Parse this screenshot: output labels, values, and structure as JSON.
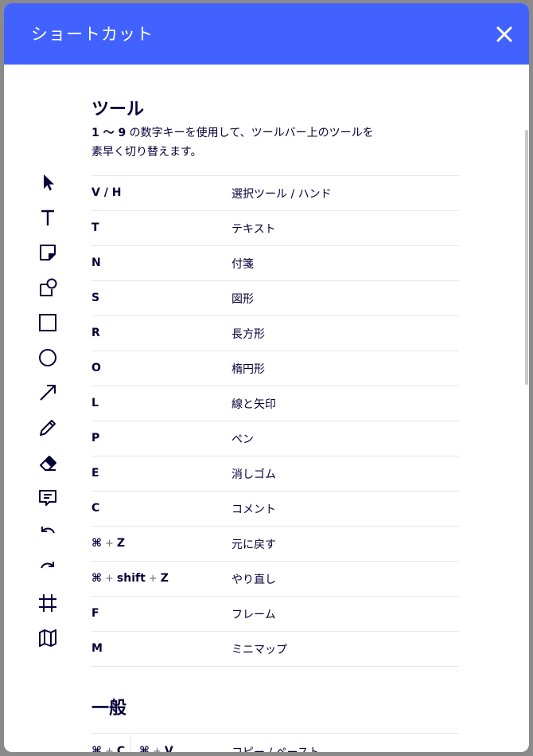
{
  "header": {
    "title": "ショートカット",
    "close_icon": "close-icon"
  },
  "accent_color": "#4262ff",
  "tools_section": {
    "title": "ツール",
    "desc_bold": "1 〜 9",
    "desc_line1": " の数字キーを使用して、ツールバー上のツールを",
    "desc_line2": "素早く切り替えます。",
    "rows": [
      {
        "key": "V / H",
        "label": "選択ツール / ハンド",
        "icon": "cursor-icon"
      },
      {
        "key": "T",
        "label": "テキスト",
        "icon": "text-icon"
      },
      {
        "key": "N",
        "label": "付箋",
        "icon": "sticky-note-icon"
      },
      {
        "key": "S",
        "label": "図形",
        "icon": "shapes-icon"
      },
      {
        "key": "R",
        "label": "長方形",
        "icon": "rectangle-icon"
      },
      {
        "key": "O",
        "label": "楕円形",
        "icon": "ellipse-icon"
      },
      {
        "key": "L",
        "label": "線と矢印",
        "icon": "arrow-icon"
      },
      {
        "key": "P",
        "label": "ペン",
        "icon": "pen-icon"
      },
      {
        "key": "E",
        "label": "消しゴム",
        "icon": "eraser-icon"
      },
      {
        "key": "C",
        "label": "コメント",
        "icon": "comment-icon"
      },
      {
        "key_cmd": "⌘",
        "key_plus": "+",
        "key_last": "Z",
        "label": "元に戻す",
        "icon": "undo-icon"
      },
      {
        "key_cmd": "⌘",
        "key_plus": "+",
        "key_mid": "shift",
        "key_plus2": "+",
        "key_last": "Z",
        "label": "やり直し",
        "icon": "redo-icon"
      },
      {
        "key": "F",
        "label": "フレーム",
        "icon": "frame-icon"
      },
      {
        "key": "M",
        "label": "ミニマップ",
        "icon": "map-icon"
      }
    ]
  },
  "general_section": {
    "title": "一般",
    "first_row": {
      "key1_cmd": "⌘",
      "key1_plus": "+",
      "key1_last": "C",
      "key2_cmd": "⌘",
      "key2_plus": "+",
      "key2_last": "V",
      "label": "コピー / ペースト"
    }
  }
}
